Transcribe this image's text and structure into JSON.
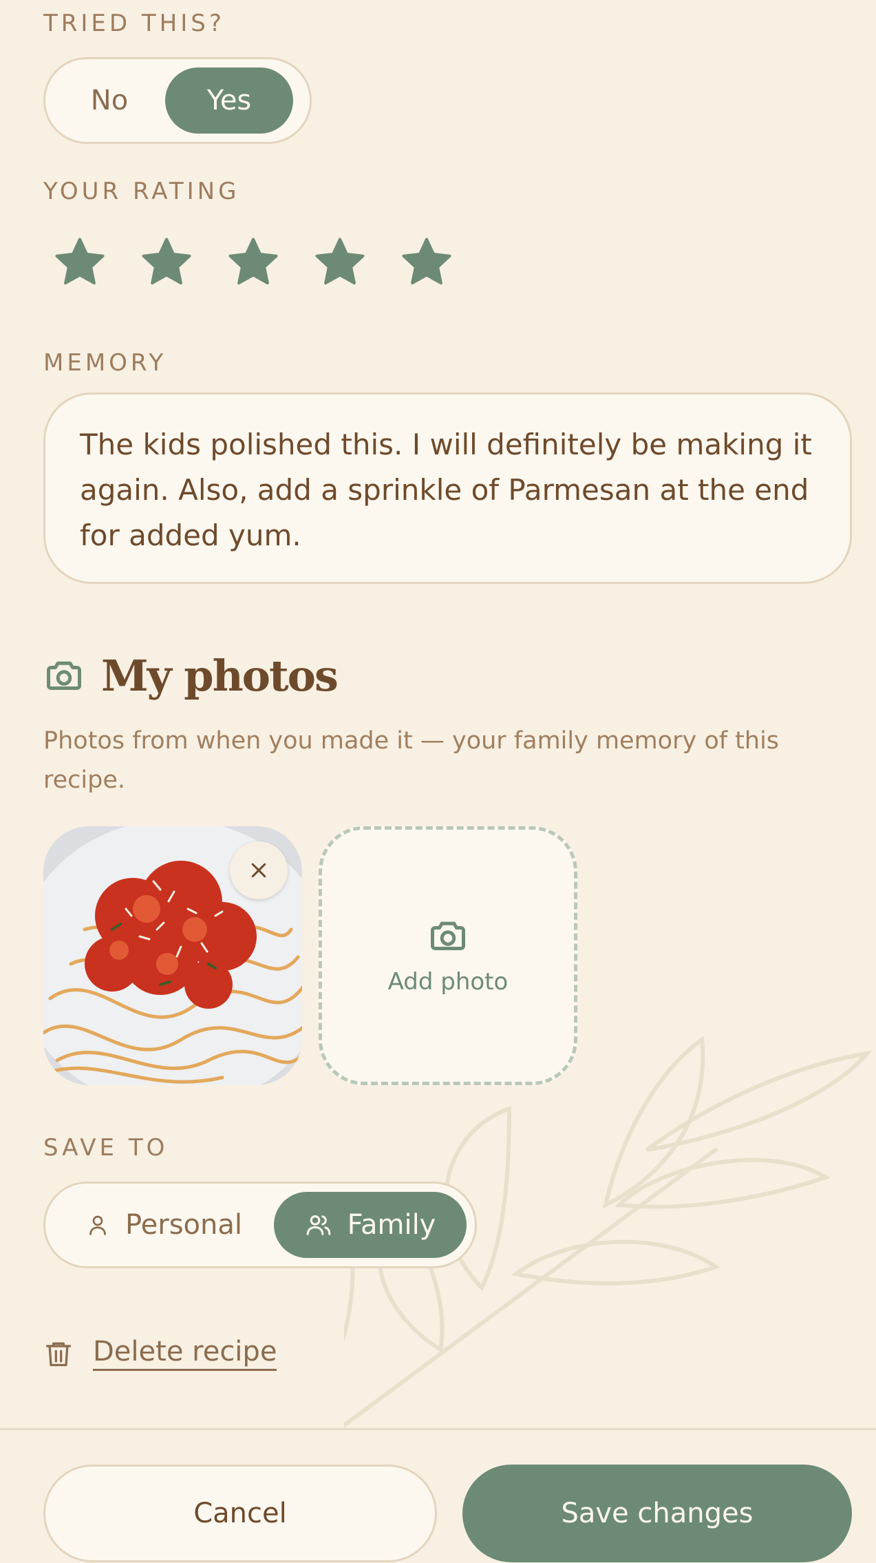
{
  "tried": {
    "label": "TRIED THIS?",
    "options": [
      "No",
      "Yes"
    ],
    "selected": "Yes"
  },
  "rating": {
    "label": "YOUR RATING",
    "value": 5,
    "max": 5
  },
  "memory": {
    "label": "MEMORY",
    "text": "The kids polished this. I will definitely be making it again. Also, add a sprinkle of Parmesan at the end for added yum."
  },
  "photos": {
    "title": "My photos",
    "description": "Photos from when you made it — your family memory of this recipe.",
    "add_label": "Add photo"
  },
  "save_to": {
    "label": "SAVE TO",
    "options": [
      "Personal",
      "Family"
    ],
    "selected": "Family"
  },
  "delete_label": "Delete recipe",
  "footer": {
    "cancel": "Cancel",
    "save": "Save changes"
  },
  "colors": {
    "accent": "#6d8b74",
    "background": "#f8f0e3",
    "text": "#7a5232"
  }
}
